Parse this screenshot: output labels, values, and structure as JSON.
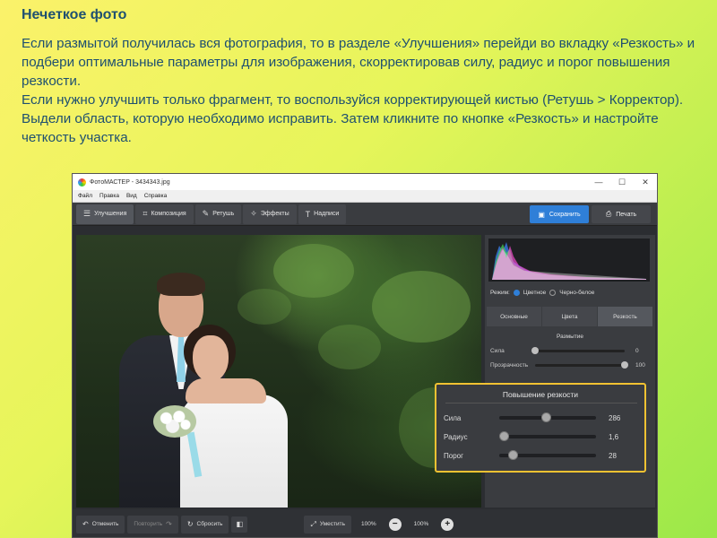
{
  "slide": {
    "title": "Нечеткое фото",
    "para1": "Если размытой получилась вся фотография, то в разделе «Улучшения» перейди во вкладку «Резкость» и подбери оптимальные параметры для изображения, скорректировав силу, радиус и порог повышения резкости.",
    "para2": "Если нужно улучшить только фрагмент, то воспользуйся корректирующей кистью (Ретушь > Корректор). Выдели область, которую необходимо исправить. Затем кликните по кнопке «Резкость» и настройте четкость участка."
  },
  "window": {
    "title": "ФотоМАСТЕР - 3434343.jpg",
    "controls": [
      "—",
      "☐",
      "✕"
    ]
  },
  "menu": [
    "Файл",
    "Правка",
    "Вид",
    "Справка"
  ],
  "toolbar": {
    "tabs": [
      {
        "label": "Улучшения",
        "icon": "sliders-icon"
      },
      {
        "label": "Композиция",
        "icon": "crop-icon"
      },
      {
        "label": "Ретушь",
        "icon": "brush-icon"
      },
      {
        "label": "Эффекты",
        "icon": "wand-icon"
      },
      {
        "label": "Надписи",
        "icon": "text-icon"
      }
    ],
    "save_label": "Сохранить",
    "print_label": "Печать"
  },
  "panel": {
    "mode_label": "Режим:",
    "mode_color": "Цветное",
    "mode_bw": "Черно-белое",
    "tabs": [
      "Основные",
      "Цвета",
      "Резкость"
    ],
    "blur_section": "Размытие",
    "blur_sliders": [
      {
        "label": "Сила",
        "value": "0",
        "level": 0.0
      },
      {
        "label": "Прозрачность",
        "value": "100",
        "level": 1.0
      }
    ],
    "sharp_section": "Повышение резкости",
    "sharp_sliders": [
      {
        "label": "Сила",
        "value": "286",
        "level": 0.48
      },
      {
        "label": "Радиус",
        "value": "1,6",
        "level": 0.05
      },
      {
        "label": "Порог",
        "value": "28",
        "level": 0.14
      }
    ]
  },
  "bottombar": {
    "undo_label": "Отменить",
    "redo_label": "Повторить",
    "reset_label": "Сбросить",
    "fit_label": "Уместить",
    "zoom_value_1": "100%",
    "zoom_value_2": "100%",
    "zoom_minus": "−",
    "zoom_plus": "+"
  },
  "colors": {
    "accent": "#2f7fd8",
    "highlight": "#f1c232",
    "slide_text": "#1f5070"
  }
}
